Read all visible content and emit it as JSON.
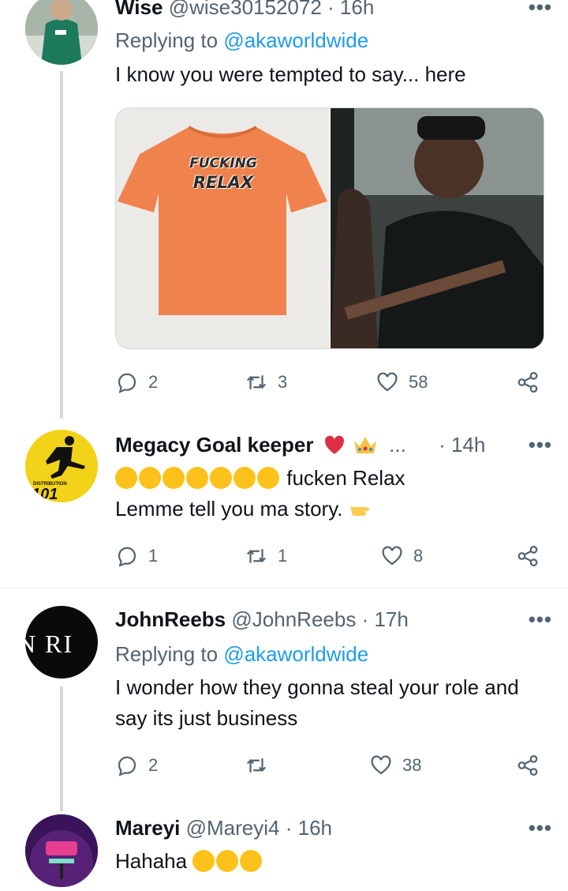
{
  "tweets": [
    {
      "name": "Wise",
      "handle": "@wise30152072",
      "time": "· 16h",
      "replying_label": "Replying to",
      "replying_to": "@akaworldwide",
      "text": "I know you were tempted to say... here",
      "shirt_text_line1": "FUCKING",
      "shirt_text_line2": "RELAX",
      "stats": {
        "replies": "2",
        "retweets": "3",
        "likes": "58"
      }
    },
    {
      "name": "Megacy Goal keeper",
      "ellipsis": "...",
      "time": "· 14h",
      "avatar_text": "101",
      "avatar_small": "DISTRIBUTION",
      "text_line1": "fucken Relax",
      "text_line2": "Lemme tell you ma story.",
      "stats": {
        "replies": "1",
        "retweets": "1",
        "likes": "8"
      }
    },
    {
      "name": "JohnReebs",
      "handle": "@JohnReebs",
      "time": "· 17h",
      "avatar_text": "N RI",
      "replying_label": "Replying to",
      "replying_to": "@akaworldwide",
      "text": "I wonder how they gonna steal your role and say its just business",
      "stats": {
        "replies": "2",
        "retweets": "",
        "likes": "38"
      }
    },
    {
      "name": "Mareyi",
      "handle": "@Mareyi4",
      "time": "· 16h",
      "text": "Hahaha"
    }
  ],
  "more_icon": "•••",
  "colors": {
    "accent": "#1d9bf0",
    "muted": "#536471",
    "heart": "#e0245e",
    "line": "#cfd9de"
  }
}
